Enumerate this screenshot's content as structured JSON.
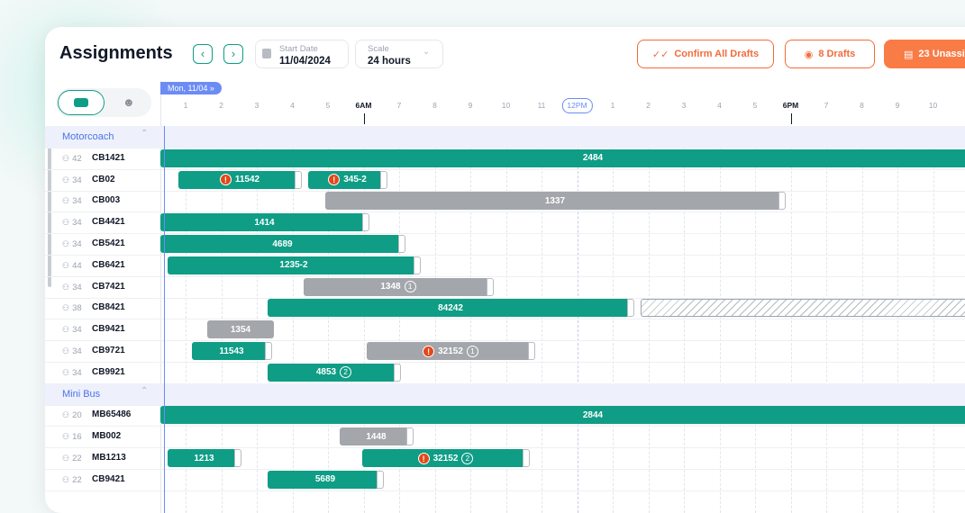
{
  "header": {
    "title": "Assignments",
    "prev_icon": "chevron-left-icon",
    "next_icon": "chevron-right-icon",
    "start_date_label": "Start Date",
    "start_date_value": "11/04/2024",
    "scale_label": "Scale",
    "scale_value": "24 hours",
    "confirm_drafts": "Confirm All Drafts",
    "drafts": "8 Drafts",
    "unassigned": "23 Unassi"
  },
  "colors": {
    "accent_green": "#0f9d86",
    "accent_orange": "#f97c46",
    "accent_blue": "#6c8cf5",
    "draft_gray": "#a3a6ab",
    "warning": "#e2481a"
  },
  "view_toggle": {
    "active": "bus-icon",
    "inactive": "driver-icon"
  },
  "timeline": {
    "day_label": "Mon, 11/04",
    "ticks": [
      "1",
      "2",
      "3",
      "4",
      "5",
      "6AM",
      "7",
      "8",
      "9",
      "10",
      "11",
      "12PM",
      "1",
      "2",
      "3",
      "4",
      "5",
      "6PM",
      "7",
      "8",
      "9",
      "10"
    ]
  },
  "groups": [
    {
      "name": "Motorcoach",
      "vehicles": [
        {
          "cap": "42",
          "id": "CB1421"
        },
        {
          "cap": "34",
          "id": "CB02"
        },
        {
          "cap": "34",
          "id": "CB003"
        },
        {
          "cap": "34",
          "id": "CB4421"
        },
        {
          "cap": "34",
          "id": "CB5421"
        },
        {
          "cap": "44",
          "id": "CB6421"
        },
        {
          "cap": "34",
          "id": "CB7421"
        },
        {
          "cap": "38",
          "id": "CB8421"
        },
        {
          "cap": "34",
          "id": "CB9421"
        },
        {
          "cap": "34",
          "id": "CB9721"
        },
        {
          "cap": "34",
          "id": "CB9921"
        }
      ]
    },
    {
      "name": "Mini Bus",
      "vehicles": [
        {
          "cap": "20",
          "id": "MB65486"
        },
        {
          "cap": "16",
          "id": "MB002"
        },
        {
          "cap": "22",
          "id": "MB1213"
        },
        {
          "cap": "22",
          "id": "CB9421"
        }
      ]
    }
  ],
  "trips": [
    {
      "label": "2484"
    },
    {
      "label": "11542",
      "warn": true
    },
    {
      "label": "345-2",
      "warn": true
    },
    {
      "label": "1337"
    },
    {
      "label": "1414"
    },
    {
      "label": "4689"
    },
    {
      "label": "1235-2"
    },
    {
      "label": "1348",
      "count": "1"
    },
    {
      "label": "84242"
    },
    {
      "label": "1354"
    },
    {
      "label": "11543"
    },
    {
      "label": "32152",
      "warn": true,
      "count": "1"
    },
    {
      "label": "4853",
      "count": "2"
    },
    {
      "label": "2844"
    },
    {
      "label": "1448"
    },
    {
      "label": "1213"
    },
    {
      "label": "32152",
      "warn": true,
      "count": "2"
    },
    {
      "label": "5689"
    }
  ]
}
